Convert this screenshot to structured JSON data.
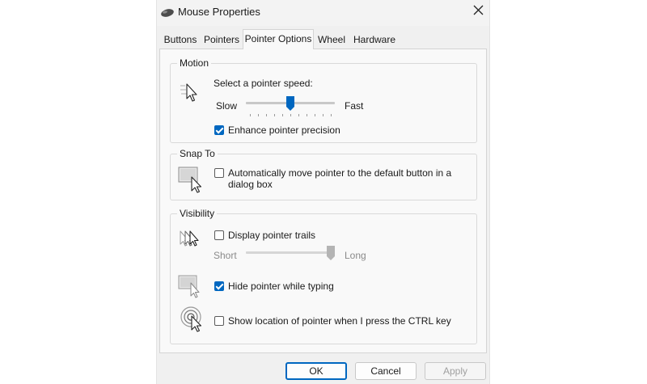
{
  "window": {
    "title": "Mouse Properties"
  },
  "tabs": [
    {
      "label": "Buttons",
      "active": false
    },
    {
      "label": "Pointers",
      "active": false
    },
    {
      "label": "Pointer Options",
      "active": true
    },
    {
      "label": "Wheel",
      "active": false
    },
    {
      "label": "Hardware",
      "active": false
    }
  ],
  "motion": {
    "group_label": "Motion",
    "speed_label": "Select a pointer speed:",
    "slow_label": "Slow",
    "fast_label": "Fast",
    "speed_value": 0.5,
    "enhance_label": "Enhance pointer precision",
    "enhance_checked": true
  },
  "snap": {
    "group_label": "Snap To",
    "auto_move_line1": "Automatically move pointer to the default button in a",
    "auto_move_line2": "dialog box",
    "auto_move_checked": false
  },
  "visibility": {
    "group_label": "Visibility",
    "trails_label": "Display pointer trails",
    "trails_checked": false,
    "short_label": "Short",
    "long_label": "Long",
    "trail_length_value": 1.0,
    "hide_label": "Hide pointer while typing",
    "hide_checked": true,
    "ctrl_label": "Show location of pointer when I press the CTRL key",
    "ctrl_checked": false
  },
  "buttons": {
    "ok": "OK",
    "cancel": "Cancel",
    "apply": "Apply"
  },
  "colors": {
    "accent": "#0067c0",
    "dialog_bg": "#f0f0f0",
    "page_bg": "#f9f9f9"
  }
}
